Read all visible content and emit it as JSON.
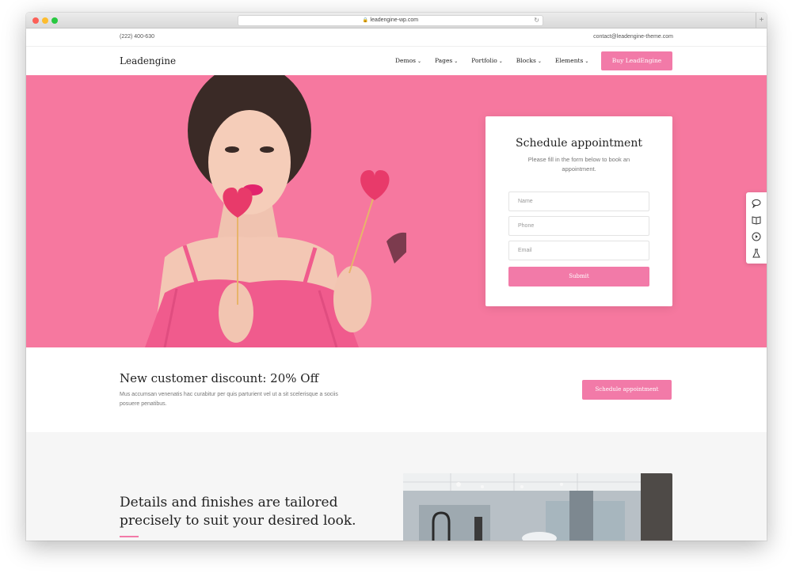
{
  "browser": {
    "url": "leadengine-wp.com"
  },
  "topbar": {
    "phone": "(222) 400-630",
    "email": "contact@leadengine-theme.com"
  },
  "nav": {
    "logo": "Leadengine",
    "items": [
      {
        "label": "Demos"
      },
      {
        "label": "Pages"
      },
      {
        "label": "Portfolio"
      },
      {
        "label": "Blocks"
      },
      {
        "label": "Elements"
      }
    ],
    "cta": "Buy LeadEngine"
  },
  "hero": {
    "background_color": "#f6789f",
    "form": {
      "title": "Schedule appointment",
      "subtitle": "Please fill in the form below to book an appointment.",
      "name_placeholder": "Name",
      "phone_placeholder": "Phone",
      "email_placeholder": "Email",
      "submit_label": "Submit"
    }
  },
  "side_tools": [
    "chat-icon",
    "book-icon",
    "play-icon",
    "flask-icon"
  ],
  "discount": {
    "title": "New customer discount: 20% Off",
    "text": "Mus accumsan venenatis hac curabitur per quis parturient vel ut a sit scelerisque a sociis posuere penatibus.",
    "button": "Schedule appointment"
  },
  "details": {
    "title": "Details and finishes are tailored precisely to suit your desired look."
  },
  "colors": {
    "accent": "#f27aa8",
    "hero_bg": "#f6789f"
  }
}
